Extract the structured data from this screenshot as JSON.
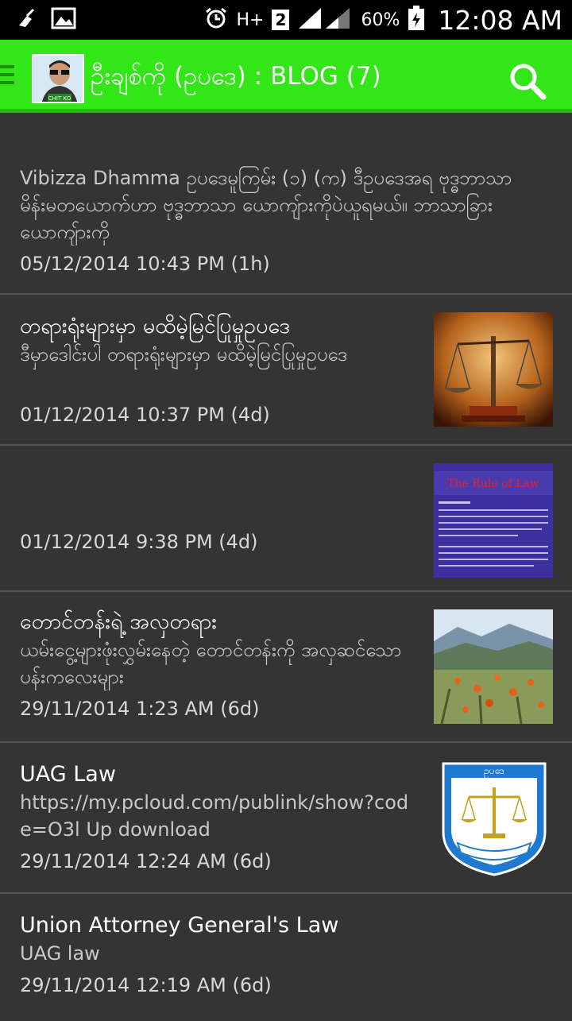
{
  "status_bar": {
    "network": "H+",
    "sim_slot": "2",
    "battery": "60%",
    "time": "12:08 AM",
    "icons": [
      "cleaner-icon",
      "image-icon",
      "alarm-icon",
      "signal-icon",
      "battery-icon"
    ]
  },
  "app_bar": {
    "title": "ဦးချစ်ကို (ဥပဒေ) :   BLOG (7)",
    "avatar_caption": "CHIT KO",
    "accent_color": "#33e617"
  },
  "posts": [
    {
      "title": "",
      "description": "Vibizza Dhamma ဥပဒေမူကြမ်း (၁) (က) ဒီဥပဒေအရ ဗုဒ္ဓဘာသာမိန်းမတယောက်ဟာ ဗုဒ္ဓဘာသာ ယောကျ်ားကိုပဲယူရမယ်။ ဘာသာခြားယောကျ်ားကို",
      "date": "05/12/2014 10:43 PM (1h)",
      "thumbnail": ""
    },
    {
      "title": "တရားရုံးများမှာ မထိမဲ့မြင်ပြုမှုဥပဒေ",
      "description": "ဒီမှာဒေါင်းပါ တရားရုံးများမှာ မထိမဲ့မြင်ပြုမှုဥပဒေ",
      "date": "01/12/2014 10:37 PM (4d)",
      "thumbnail": "scales-of-justice"
    },
    {
      "title": "",
      "description": "",
      "date": "01/12/2014 9:38 PM (4d)",
      "thumbnail": "the-rule-of-law-slide",
      "thumbnail_heading": "The Rule of Law"
    },
    {
      "title": "တောင်တန်းရဲ့ အလှတရား",
      "description": "ယမ်းငွေ့များဖုံးလွှမ်းနေတဲ့ တောင်တန်းကို အလှဆင်သော ပန်းကလေးများ",
      "date": "29/11/2014 1:23 AM (6d)",
      "thumbnail": "mountain-flowers"
    },
    {
      "title": "UAG Law",
      "description": "https://my.pcloud.com/publink/show?code=O3l Up download",
      "date": "29/11/2014 12:24 AM (6d)",
      "thumbnail": "uag-emblem",
      "emblem_text": "ဥပဒေ"
    },
    {
      "title": "Union Attorney General's Law",
      "description": "UAG law",
      "date": "29/11/2014 12:19 AM (6d)",
      "thumbnail": ""
    }
  ]
}
